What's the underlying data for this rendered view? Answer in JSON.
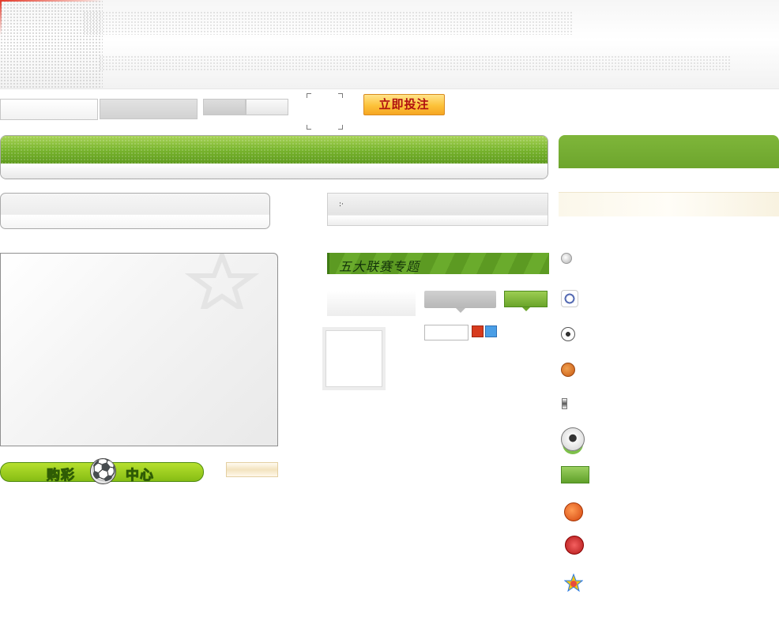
{
  "header": {
    "brand_color": "#e43a2a",
    "background": "#f6f6f6"
  },
  "toolbar": {
    "submit_label": "立即投注",
    "submit_color": "#fcc23a"
  },
  "main": {
    "banner_title": "五大联赛专题",
    "bullet_glyph": ":·",
    "accent_green": "#79b52e"
  },
  "buy_center": {
    "left_text": "购彩",
    "right_text": "中心",
    "ball_icon": "soccer-ball-icon"
  },
  "sidebar": {
    "header_color": "#6da52d",
    "icons": [
      "play-arrow-icon",
      "sports-mascot-icon",
      "soccer-ball-icon",
      "basketball-icon",
      "small-bar-icon",
      "soccer-ball-pitch-icon",
      "soccer-field-icon",
      "basketball-large-icon",
      "badge-icon",
      "star-sport-icon"
    ]
  }
}
